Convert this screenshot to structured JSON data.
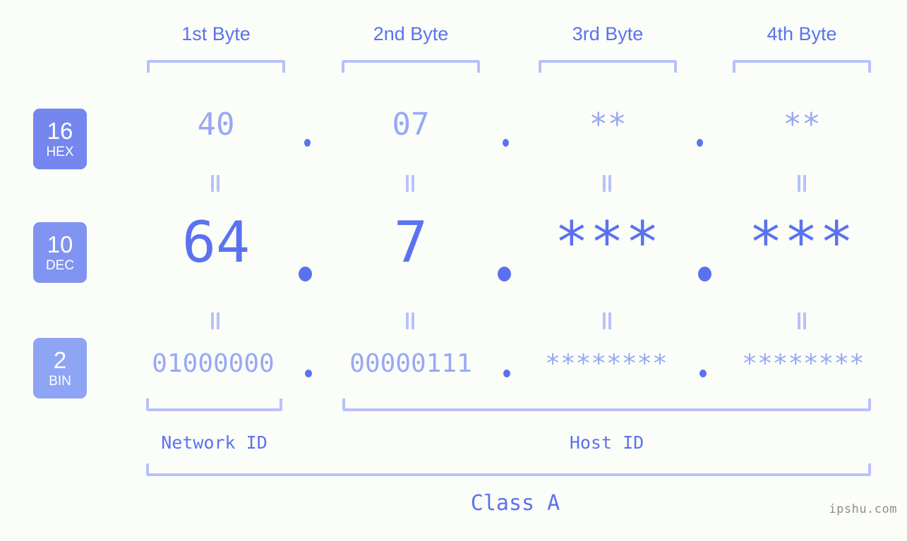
{
  "header": {
    "byte_labels": [
      "1st Byte",
      "2nd Byte",
      "3rd Byte",
      "4th Byte"
    ]
  },
  "badges": [
    {
      "num": "16",
      "unit": "HEX",
      "color": "#7586ee"
    },
    {
      "num": "10",
      "unit": "DEC",
      "color": "#8193f0"
    },
    {
      "num": "2",
      "unit": "BIN",
      "color": "#8ea4f4"
    }
  ],
  "rows": {
    "hex": {
      "values": [
        "40",
        "07",
        "**",
        "**"
      ],
      "separator": "."
    },
    "dec": {
      "values": [
        "64",
        "7",
        "***",
        "***"
      ],
      "separator": "."
    },
    "bin": {
      "values": [
        "01000000",
        "00000111",
        "********",
        "********"
      ],
      "separator": "."
    }
  },
  "segments": {
    "network_id": "Network ID",
    "host_id": "Host ID"
  },
  "class_label": "Class A",
  "watermark": "ipshu.com",
  "equals_symbol": "=",
  "colors": {
    "background": "#fbfdf8",
    "accent_strong": "#5b72f0",
    "accent_light": "#98a8f6",
    "bracket": "#b7c1fb",
    "watermark": "#8d8d8d"
  }
}
